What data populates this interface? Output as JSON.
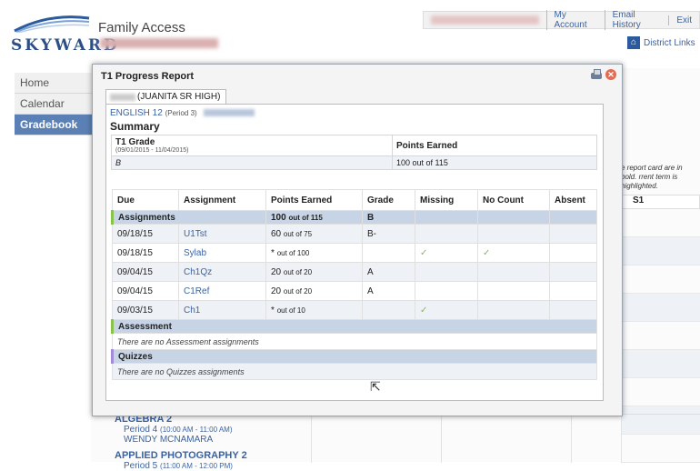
{
  "app": {
    "title": "Family Access",
    "logo_text": "SKYWARD"
  },
  "toplinks": [
    "My Account",
    "Email History",
    "Exit"
  ],
  "district_links": "District Links",
  "nav": [
    {
      "label": "Home",
      "active": false
    },
    {
      "label": "Calendar",
      "active": false
    },
    {
      "label": "Gradebook",
      "active": true
    }
  ],
  "background": {
    "note": "e report card are in bold. rrent term is highlighted.",
    "s1_header": "S1",
    "classes": [
      {
        "name": "ALGEBRA 2",
        "period": "Period 4",
        "time": "(10:00 AM - 11:00 AM)",
        "teacher": "WENDY MCNAMARA"
      },
      {
        "name": "APPLIED PHOTOGRAPHY 2",
        "period": "Period 5",
        "time": "(11:00 AM - 12:00 PM)",
        "teacher": ""
      }
    ]
  },
  "dialog": {
    "title": "T1 Progress Report",
    "tab_label": "(JUANITA SR HIGH)",
    "course": "ENGLISH 12",
    "course_period": "(Period 3)",
    "summary_heading": "Summary",
    "summary": {
      "grade_label": "T1 Grade",
      "date_range": "(09/01/2015 - 11/04/2015)",
      "grade_value": "B",
      "points_label": "Points Earned",
      "points_value": "100 out of 115"
    },
    "columns": [
      "Due",
      "Assignment",
      "Points Earned",
      "Grade",
      "Missing",
      "No Count",
      "Absent"
    ],
    "groups": [
      {
        "name": "Assignments",
        "points": "100",
        "points_suffix": "out of 115",
        "grade": "B",
        "rows": [
          {
            "due": "09/18/15",
            "name": "U1Tst",
            "points": "60",
            "points_suffix": "out of 75",
            "grade": "B-",
            "missing": "",
            "nocount": "",
            "absent": ""
          },
          {
            "due": "09/18/15",
            "name": "Sylab",
            "points": "*",
            "points_suffix": "out of 100",
            "grade": "",
            "missing": "✓",
            "nocount": "✓",
            "absent": ""
          },
          {
            "due": "09/04/15",
            "name": "Ch1Qz",
            "points": "20",
            "points_suffix": "out of 20",
            "grade": "A",
            "missing": "",
            "nocount": "",
            "absent": ""
          },
          {
            "due": "09/04/15",
            "name": "C1Ref",
            "points": "20",
            "points_suffix": "out of 20",
            "grade": "A",
            "missing": "",
            "nocount": "",
            "absent": ""
          },
          {
            "due": "09/03/15",
            "name": "Ch1",
            "points": "*",
            "points_suffix": "out of 10",
            "grade": "",
            "missing": "✓",
            "nocount": "",
            "absent": ""
          }
        ]
      },
      {
        "name": "Assessment",
        "empty_text": "There are no Assessment assignments"
      },
      {
        "name": "Quizzes",
        "empty_text": "There are no Quizzes assignments"
      }
    ]
  }
}
